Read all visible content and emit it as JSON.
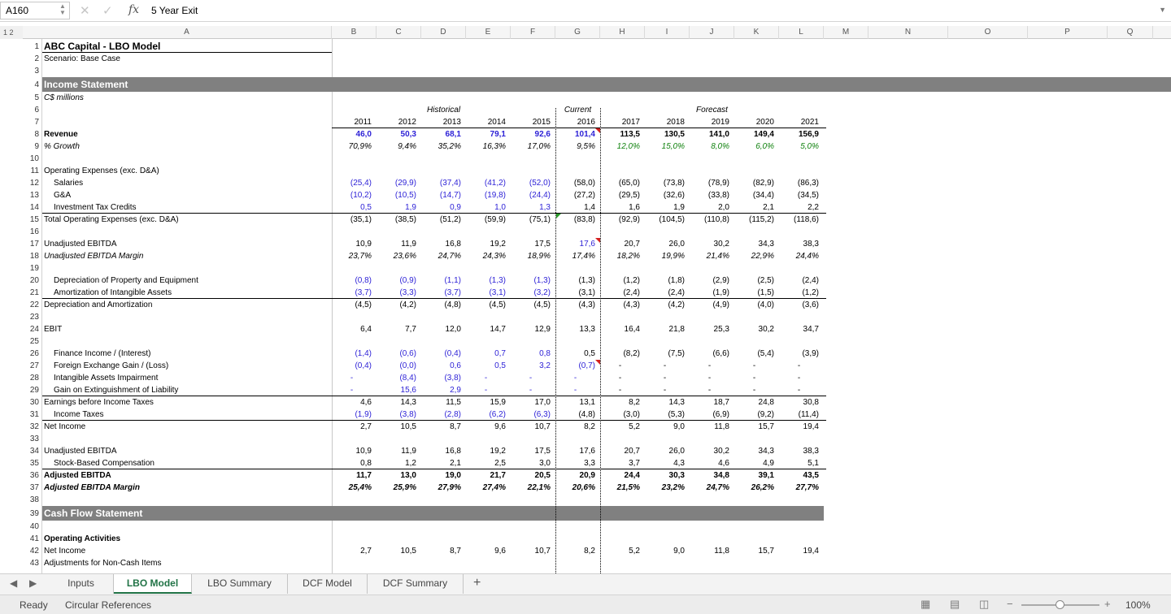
{
  "formula_bar": {
    "name_box": "A160",
    "formula_text": "5 Year Exit",
    "fx_label": "fx"
  },
  "outline_levels": "1 2",
  "columns": [
    "A",
    "B",
    "C",
    "D",
    "E",
    "F",
    "G",
    "H",
    "I",
    "J",
    "K",
    "L",
    "M",
    "N",
    "O",
    "P",
    "Q"
  ],
  "rows": [
    "1",
    "2",
    "3",
    "4",
    "5",
    "6",
    "7",
    "8",
    "9",
    "10",
    "11",
    "12",
    "13",
    "14",
    "15",
    "16",
    "17",
    "18",
    "19",
    "20",
    "21",
    "22",
    "23",
    "24",
    "25",
    "26",
    "27",
    "28",
    "29",
    "30",
    "31",
    "32",
    "33",
    "34",
    "35",
    "36",
    "37",
    "38",
    "39",
    "40",
    "41",
    "42",
    "43"
  ],
  "title": "ABC Capital - LBO Model",
  "scenario": "Scenario: Base Case",
  "section_income": "Income Statement",
  "units": "C$ millions",
  "section_cashflow": "Cash Flow Statement",
  "period_labels": {
    "historical": "Historical",
    "current": "Current",
    "forecast": "Forecast"
  },
  "years": [
    "2011",
    "2012",
    "2013",
    "2014",
    "2015",
    "2016",
    "2017",
    "2018",
    "2019",
    "2020",
    "2021"
  ],
  "table_rows": [
    {
      "row": 8,
      "label": "Revenue",
      "style": "b",
      "values": [
        "46,0",
        "50,3",
        "68,1",
        "79,1",
        "92,6",
        "101,4",
        "113,5",
        "130,5",
        "141,0",
        "149,4",
        "156,9"
      ],
      "color": "bluehist"
    },
    {
      "row": 9,
      "label": "% Growth",
      "style": "i",
      "values": [
        "70,9%",
        "9,4%",
        "35,2%",
        "16,3%",
        "17,0%",
        "9,5%",
        "12,0%",
        "15,0%",
        "8,0%",
        "6,0%",
        "5,0%"
      ],
      "color": "greenfc"
    },
    {
      "row": 11,
      "label": "Operating Expenses (exc. D&A)",
      "style": "",
      "values": []
    },
    {
      "row": 12,
      "label": "Salaries",
      "indent": 1,
      "values": [
        "(25,4)",
        "(29,9)",
        "(37,4)",
        "(41,2)",
        "(52,0)",
        "(58,0)",
        "(65,0)",
        "(73,8)",
        "(78,9)",
        "(82,9)",
        "(86,3)"
      ],
      "color": "bluehist"
    },
    {
      "row": 13,
      "label": "G&A",
      "indent": 1,
      "values": [
        "(10,2)",
        "(10,5)",
        "(14,7)",
        "(19,8)",
        "(24,4)",
        "(27,2)",
        "(29,5)",
        "(32,6)",
        "(33,8)",
        "(34,4)",
        "(34,5)"
      ],
      "color": "bluehist"
    },
    {
      "row": 14,
      "label": "Investment Tax Credits",
      "indent": 1,
      "values": [
        "0,5",
        "1,9",
        "0,9",
        "1,0",
        "1,3",
        "1,4",
        "1,6",
        "1,9",
        "2,0",
        "2,1",
        "2,2"
      ],
      "color": "bluehist"
    },
    {
      "row": 15,
      "label": "Total Operating Expenses (exc. D&A)",
      "values": [
        "(35,1)",
        "(38,5)",
        "(51,2)",
        "(59,9)",
        "(75,1)",
        "(83,8)",
        "(92,9)",
        "(104,5)",
        "(110,8)",
        "(115,2)",
        "(118,6)"
      ]
    },
    {
      "row": 17,
      "label": "Unadjusted EBITDA",
      "values": [
        "10,9",
        "11,9",
        "16,8",
        "19,2",
        "17,5",
        "17,6",
        "20,7",
        "26,0",
        "30,2",
        "34,3",
        "38,3"
      ],
      "color": "bluecur"
    },
    {
      "row": 18,
      "label": "Unadjusted EBITDA Margin",
      "style": "i",
      "values": [
        "23,7%",
        "23,6%",
        "24,7%",
        "24,3%",
        "18,9%",
        "17,4%",
        "18,2%",
        "19,9%",
        "21,4%",
        "22,9%",
        "24,4%"
      ]
    },
    {
      "row": 20,
      "label": "Depreciation of Property and Equipment",
      "indent": 1,
      "values": [
        "(0,8)",
        "(0,9)",
        "(1,1)",
        "(1,3)",
        "(1,3)",
        "(1,3)",
        "(1,2)",
        "(1,8)",
        "(2,9)",
        "(2,5)",
        "(2,4)"
      ],
      "color": "bluehist"
    },
    {
      "row": 21,
      "label": "Amortization of Intangible Assets",
      "indent": 1,
      "values": [
        "(3,7)",
        "(3,3)",
        "(3,7)",
        "(3,1)",
        "(3,2)",
        "(3,1)",
        "(2,4)",
        "(2,4)",
        "(1,9)",
        "(1,5)",
        "(1,2)"
      ],
      "color": "bluehist"
    },
    {
      "row": 22,
      "label": "Depreciation and Amortization",
      "values": [
        "(4,5)",
        "(4,2)",
        "(4,8)",
        "(4,5)",
        "(4,5)",
        "(4,3)",
        "(4,3)",
        "(4,2)",
        "(4,9)",
        "(4,0)",
        "(3,6)"
      ]
    },
    {
      "row": 24,
      "label": "EBIT",
      "values": [
        "6,4",
        "7,7",
        "12,0",
        "14,7",
        "12,9",
        "13,3",
        "16,4",
        "21,8",
        "25,3",
        "30,2",
        "34,7"
      ]
    },
    {
      "row": 26,
      "label": "Finance Income / (Interest)",
      "indent": 1,
      "values": [
        "(1,4)",
        "(0,6)",
        "(0,4)",
        "0,7",
        "0,8",
        "0,5",
        "(8,2)",
        "(7,5)",
        "(6,6)",
        "(5,4)",
        "(3,9)"
      ],
      "color": "bluehist"
    },
    {
      "row": 27,
      "label": "Foreign Exchange Gain / (Loss)",
      "indent": 1,
      "values": [
        "(0,4)",
        "(0,0)",
        "0,6",
        "0,5",
        "3,2",
        "(0,7)",
        "-",
        "-",
        "-",
        "-",
        "-"
      ],
      "color": "bluehistcur"
    },
    {
      "row": 28,
      "label": "Intangible Assets Impairment",
      "indent": 1,
      "values": [
        "-",
        "(8,4)",
        "(3,8)",
        "-",
        "-",
        "-",
        "-",
        "-",
        "-",
        "-",
        "-"
      ],
      "color": "bluehistcur"
    },
    {
      "row": 29,
      "label": "Gain on Extinguishment of Liability",
      "indent": 1,
      "values": [
        "-",
        "15,6",
        "2,9",
        "-",
        "-",
        "-",
        "-",
        "-",
        "-",
        "-",
        "-"
      ],
      "color": "bluehistcur"
    },
    {
      "row": 30,
      "label": "Earnings before Income Taxes",
      "values": [
        "4,6",
        "14,3",
        "11,5",
        "15,9",
        "17,0",
        "13,1",
        "8,2",
        "14,3",
        "18,7",
        "24,8",
        "30,8"
      ]
    },
    {
      "row": 31,
      "label": "Income Taxes",
      "indent": 1,
      "values": [
        "(1,9)",
        "(3,8)",
        "(2,8)",
        "(6,2)",
        "(6,3)",
        "(4,8)",
        "(3,0)",
        "(5,3)",
        "(6,9)",
        "(9,2)",
        "(11,4)"
      ],
      "color": "bluehist"
    },
    {
      "row": 32,
      "label": "Net Income",
      "values": [
        "2,7",
        "10,5",
        "8,7",
        "9,6",
        "10,7",
        "8,2",
        "5,2",
        "9,0",
        "11,8",
        "15,7",
        "19,4"
      ]
    },
    {
      "row": 34,
      "label": "Unadjusted EBITDA",
      "values": [
        "10,9",
        "11,9",
        "16,8",
        "19,2",
        "17,5",
        "17,6",
        "20,7",
        "26,0",
        "30,2",
        "34,3",
        "38,3"
      ]
    },
    {
      "row": 35,
      "label": "Stock-Based Compensation",
      "indent": 1,
      "values": [
        "0,8",
        "1,2",
        "2,1",
        "2,5",
        "3,0",
        "3,3",
        "3,7",
        "4,3",
        "4,6",
        "4,9",
        "5,1"
      ]
    },
    {
      "row": 36,
      "label": "Adjusted EBITDA",
      "style": "b",
      "values": [
        "11,7",
        "13,0",
        "19,0",
        "21,7",
        "20,5",
        "20,9",
        "24,4",
        "30,3",
        "34,8",
        "39,1",
        "43,5"
      ]
    },
    {
      "row": 37,
      "label": "Adjusted EBITDA Margin",
      "style": "bi",
      "values": [
        "25,4%",
        "25,9%",
        "27,9%",
        "27,4%",
        "22,1%",
        "20,6%",
        "21,5%",
        "23,2%",
        "24,7%",
        "26,2%",
        "27,7%"
      ]
    },
    {
      "row": 41,
      "label": "Operating Activities",
      "style": "b",
      "values": []
    },
    {
      "row": 42,
      "label": "Net Income",
      "values": [
        "2,7",
        "10,5",
        "8,7",
        "9,6",
        "10,7",
        "8,2",
        "5,2",
        "9,0",
        "11,8",
        "15,7",
        "19,4"
      ]
    },
    {
      "row": 43,
      "label": "Adjustments for Non-Cash Items",
      "values": []
    }
  ],
  "sheet_tabs": [
    "Inputs",
    "LBO Model",
    "LBO Summary",
    "DCF Model",
    "DCF Summary"
  ],
  "active_tab": "LBO Model",
  "add_sheet": "+",
  "status": {
    "ready": "Ready",
    "circular": "Circular References",
    "zoom": "100%"
  },
  "colors": {
    "blue": "#2b1fd6",
    "green": "#11820f",
    "band": "#808080",
    "accent": "#217346"
  }
}
